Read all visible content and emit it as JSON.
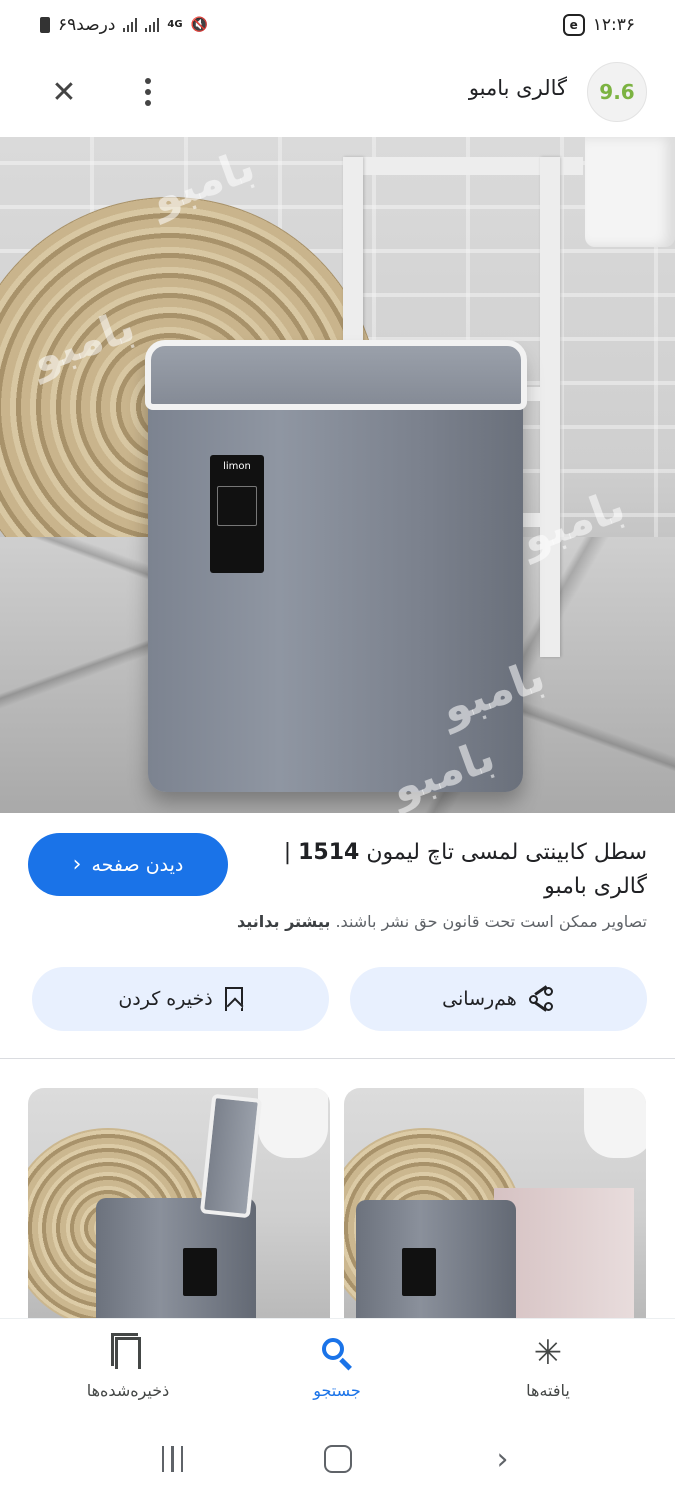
{
  "status_bar": {
    "time": "۱۲:۳۶",
    "battery": "۶۹درصد",
    "network": "4G"
  },
  "header": {
    "site_name": "گالری بامبو",
    "logo_text": "9.6"
  },
  "hero": {
    "label_brand": "limon",
    "watermark": "بامبو"
  },
  "result": {
    "title_prefix": "سطل کابینتی لمسی تاچ لیمون ",
    "title_bold": "1514",
    "title_suffix": " | گالری بامبو",
    "visit_label": "دیدن صفحه",
    "copyright_text": "تصاویر ممکن است تحت قانون حق نشر باشند. ",
    "learn_more": "بیشتر بدانید"
  },
  "actions": {
    "share_label": "هم‌رسانی",
    "save_label": "ذخیره کردن"
  },
  "bottom_nav": {
    "saved": "ذخیره‌شده‌ها",
    "search": "جستجو",
    "discover": "یافته‌ها"
  },
  "colors": {
    "accent": "#1a73e8",
    "action_bg": "#e8f0fe"
  }
}
